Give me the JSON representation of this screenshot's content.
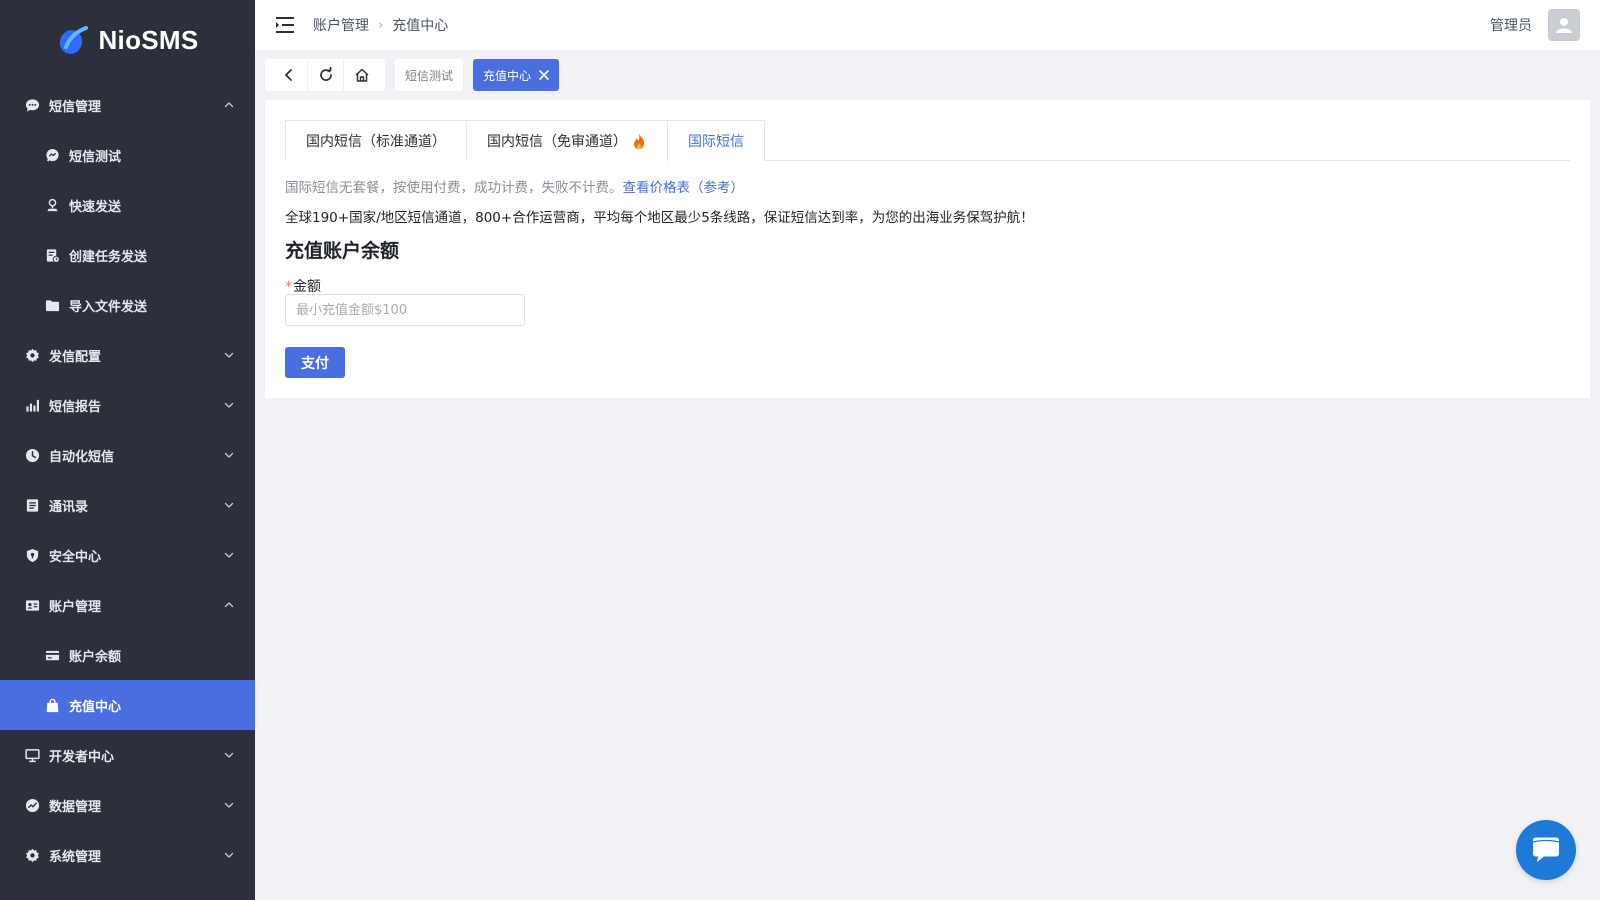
{
  "app": {
    "logo_text": "NioSMS"
  },
  "sidebar": {
    "items": [
      {
        "label": "短信管理",
        "icon": "chat-bubble-icon",
        "expanded": true,
        "sub": false
      },
      {
        "label": "短信测试",
        "icon": "chat-dots-icon",
        "sub": true
      },
      {
        "label": "快速发送",
        "icon": "user-pin-icon",
        "sub": true
      },
      {
        "label": "创建任务发送",
        "icon": "task-doc-icon",
        "sub": true
      },
      {
        "label": "导入文件发送",
        "icon": "folder-icon",
        "sub": true
      },
      {
        "label": "发信配置",
        "icon": "gear-icon",
        "expanded": false,
        "sub": false
      },
      {
        "label": "短信报告",
        "icon": "bar-chart-icon",
        "expanded": false,
        "sub": false
      },
      {
        "label": "自动化短信",
        "icon": "clock-icon",
        "expanded": false,
        "sub": false
      },
      {
        "label": "通讯录",
        "icon": "address-book-icon",
        "expanded": false,
        "sub": false
      },
      {
        "label": "安全中心",
        "icon": "shield-icon",
        "expanded": false,
        "sub": false
      },
      {
        "label": "账户管理",
        "icon": "id-card-icon",
        "expanded": true,
        "sub": false
      },
      {
        "label": "账户余额",
        "icon": "credit-card-icon",
        "sub": true
      },
      {
        "label": "充值中心",
        "icon": "shopping-bag-icon",
        "sub": true,
        "active": true
      },
      {
        "label": "开发者中心",
        "icon": "monitor-icon",
        "expanded": false,
        "sub": false
      },
      {
        "label": "数据管理",
        "icon": "trend-icon",
        "expanded": false,
        "sub": false
      },
      {
        "label": "系统管理",
        "icon": "gear-icon",
        "expanded": false,
        "sub": false
      }
    ]
  },
  "header": {
    "breadcrumb": [
      "账户管理",
      "充值中心"
    ],
    "user_name": "管理员"
  },
  "tagsbar": {
    "tags": [
      {
        "label": "短信测试",
        "active": false
      },
      {
        "label": "充值中心",
        "active": true
      }
    ]
  },
  "tabs": [
    {
      "label": "国内短信（标准通道）",
      "active": false
    },
    {
      "label": "国内短信（免审通道）",
      "active": false,
      "badge_icon": "fire-icon"
    },
    {
      "label": "国际短信",
      "active": true
    }
  ],
  "content": {
    "notice_text": "国际短信无套餐，按使用付费，成功计费，失败不计费。",
    "notice_link": "查看价格表（参考）",
    "description": "全球190+国家/地区短信通道，800+合作运营商，平均每个地区最少5条线路，保证短信达到率，为您的出海业务保驾护航！",
    "section_title": "充值账户余额",
    "amount_label": "金额",
    "amount_required_mark": "*",
    "amount_placeholder": "最小充值金额$100",
    "amount_value": "",
    "pay_button": "支付"
  },
  "colors": {
    "sidebar_bg": "#2b303b",
    "accent": "#4a6ee0",
    "chat_fab": "#1e7ad6",
    "fire": "#ff6a00"
  }
}
